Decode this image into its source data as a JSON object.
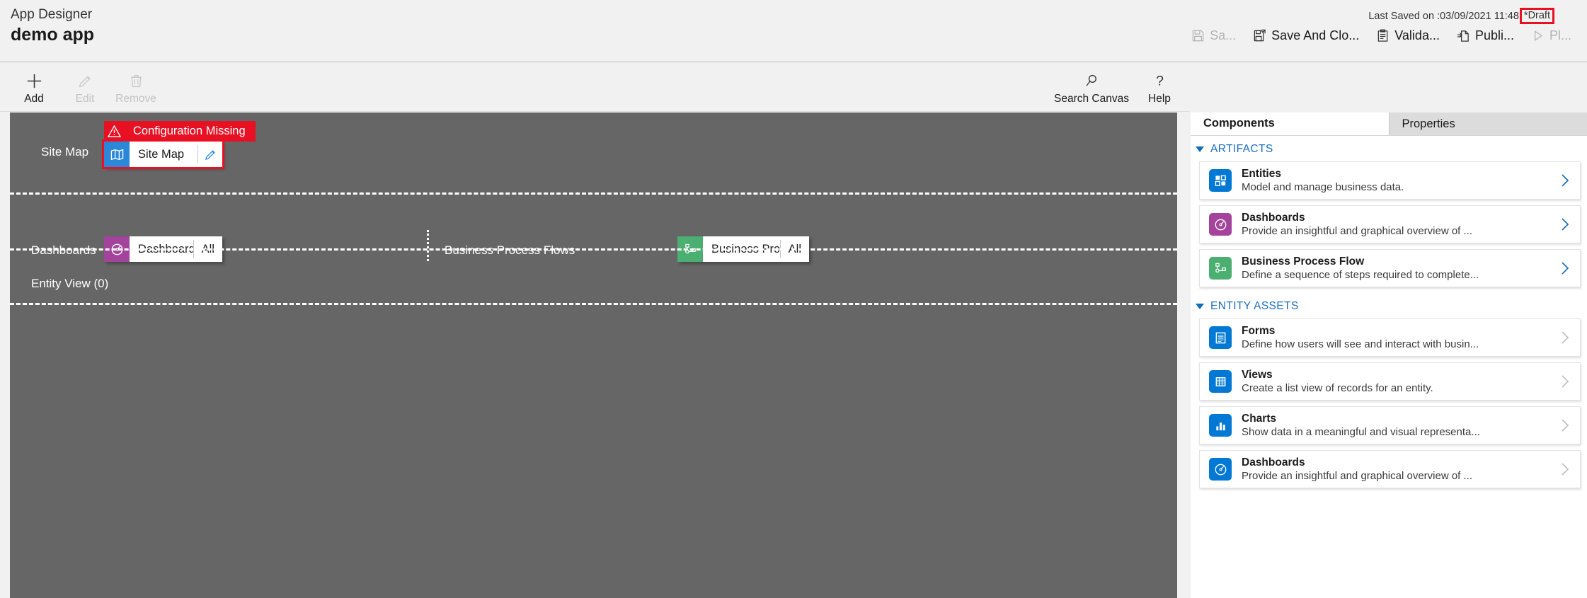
{
  "header": {
    "product": "App Designer",
    "app_name": "demo app",
    "last_saved": "Last Saved on :03/09/2021 11:48",
    "draft_badge": "*Draft",
    "commands": [
      {
        "label": "Sa...",
        "icon": "save-icon",
        "enabled": false
      },
      {
        "label": "Save And Clo...",
        "icon": "save-and-close-icon",
        "enabled": true
      },
      {
        "label": "Valida...",
        "icon": "validate-icon",
        "enabled": true
      },
      {
        "label": "Publi...",
        "icon": "publish-icon",
        "enabled": true
      },
      {
        "label": "Pl...",
        "icon": "play-icon",
        "enabled": false
      }
    ]
  },
  "commandbar": {
    "left": [
      {
        "label": "Add",
        "icon": "plus-icon",
        "enabled": true
      },
      {
        "label": "Edit",
        "icon": "pencil-icon",
        "enabled": false
      },
      {
        "label": "Remove",
        "icon": "trash-icon",
        "enabled": false
      }
    ],
    "right": [
      {
        "label": "Search Canvas",
        "icon": "search-icon",
        "enabled": true
      },
      {
        "label": "Help",
        "icon": "help-icon",
        "enabled": true
      }
    ]
  },
  "canvas": {
    "sitemap_row": {
      "label": "Site Map",
      "warning": "Configuration Missing",
      "warning_icon": "warning-triangle-icon",
      "tile": {
        "name": "Site Map",
        "icon": "sitemap-map-icon",
        "icon_color": "#2b88d8",
        "edit_icon": "pencil-icon",
        "selected": true
      }
    },
    "dashboards_row": {
      "label": "Dashboards",
      "tile": {
        "name": "Dashboards",
        "suffix": "All",
        "icon": "dashboard-gauge-icon",
        "icon_color": "#a4439b"
      }
    },
    "bpf_row": {
      "label": "Business Process Flows",
      "tile": {
        "name": "Business Proces...",
        "suffix": "All",
        "icon": "business-process-flow-icon",
        "icon_color": "#4caf72"
      }
    },
    "entityview_row": {
      "label": "Entity View (0)"
    }
  },
  "panel": {
    "tabs": [
      {
        "label": "Components",
        "active": true
      },
      {
        "label": "Properties",
        "active": false
      }
    ],
    "sections": [
      {
        "title": "ARTIFACTS",
        "cards": [
          {
            "title": "Entities",
            "desc": "Model and manage business data.",
            "icon": "entities-icon",
            "icon_color": "#0078d4",
            "chevron_enabled": true
          },
          {
            "title": "Dashboards",
            "desc": "Provide an insightful and graphical overview of ...",
            "icon": "dashboard-gauge-icon",
            "icon_color": "#a4439b",
            "chevron_enabled": true
          },
          {
            "title": "Business Process Flow",
            "desc": "Define a sequence of steps required to complete...",
            "icon": "business-process-flow-icon",
            "icon_color": "#4caf72",
            "chevron_enabled": true
          }
        ]
      },
      {
        "title": "ENTITY ASSETS",
        "cards": [
          {
            "title": "Forms",
            "desc": "Define how users will see and interact with busin...",
            "icon": "forms-icon",
            "icon_color": "#0078d4",
            "chevron_enabled": false
          },
          {
            "title": "Views",
            "desc": "Create a list view of records for an entity.",
            "icon": "views-grid-icon",
            "icon_color": "#0078d4",
            "chevron_enabled": false
          },
          {
            "title": "Charts",
            "desc": "Show data in a meaningful and visual representa...",
            "icon": "charts-bar-icon",
            "icon_color": "#0078d4",
            "chevron_enabled": false
          },
          {
            "title": "Dashboards",
            "desc": "Provide an insightful and graphical overview of ...",
            "icon": "dashboard-gauge-icon",
            "icon_color": "#0078d4",
            "chevron_enabled": false
          }
        ]
      }
    ]
  },
  "colors": {
    "canvas_bg": "#666666",
    "chrome_bg": "#f1f1f1",
    "accent_red": "#e81123",
    "link_blue": "#1b6ec2"
  }
}
